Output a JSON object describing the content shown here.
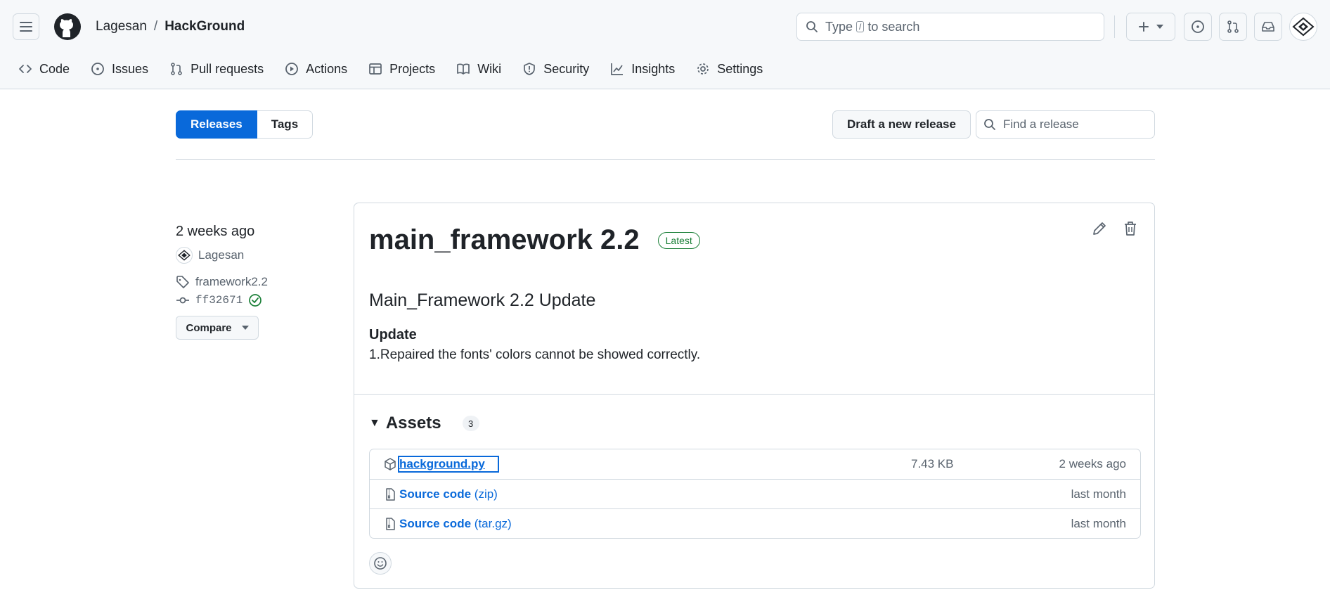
{
  "header": {
    "owner": "Lagesan",
    "separator": "/",
    "repo": "HackGround",
    "search": {
      "prefix": "Type",
      "key": "/",
      "suffix": "to search"
    }
  },
  "tabs": [
    {
      "label": "Code",
      "icon": "code-icon"
    },
    {
      "label": "Issues",
      "icon": "issue-opened-icon"
    },
    {
      "label": "Pull requests",
      "icon": "git-pull-request-icon"
    },
    {
      "label": "Actions",
      "icon": "play-icon"
    },
    {
      "label": "Projects",
      "icon": "table-icon"
    },
    {
      "label": "Wiki",
      "icon": "book-icon"
    },
    {
      "label": "Security",
      "icon": "shield-icon"
    },
    {
      "label": "Insights",
      "icon": "graph-icon"
    },
    {
      "label": "Settings",
      "icon": "gear-icon"
    }
  ],
  "subnav": {
    "releases": "Releases",
    "tags": "Tags"
  },
  "actions": {
    "draft": "Draft a new release",
    "find_placeholder": "Find a release"
  },
  "release": {
    "when": "2 weeks ago",
    "author": "Lagesan",
    "tag": "framework2.2",
    "commit": "ff32671",
    "compare": "Compare",
    "title": "main_framework 2.2",
    "badge": "Latest",
    "heading": "Main_Framework 2.2 Update",
    "subheading": "Update",
    "text": "1.Repaired the fonts' colors cannot be showed correctly."
  },
  "assets": {
    "label": "Assets",
    "count": "3",
    "items": [
      {
        "name": "hackground.py",
        "ext": "",
        "size": "7.43 KB",
        "time": "2 weeks ago"
      },
      {
        "name": "Source code",
        "ext": "(zip)",
        "size": "",
        "time": "last month"
      },
      {
        "name": "Source code",
        "ext": "(tar.gz)",
        "size": "",
        "time": "last month"
      }
    ]
  },
  "colors": {
    "accent": "#0969da",
    "success": "#1a7f37",
    "border": "#d1d9e0",
    "muted": "#59636e"
  }
}
